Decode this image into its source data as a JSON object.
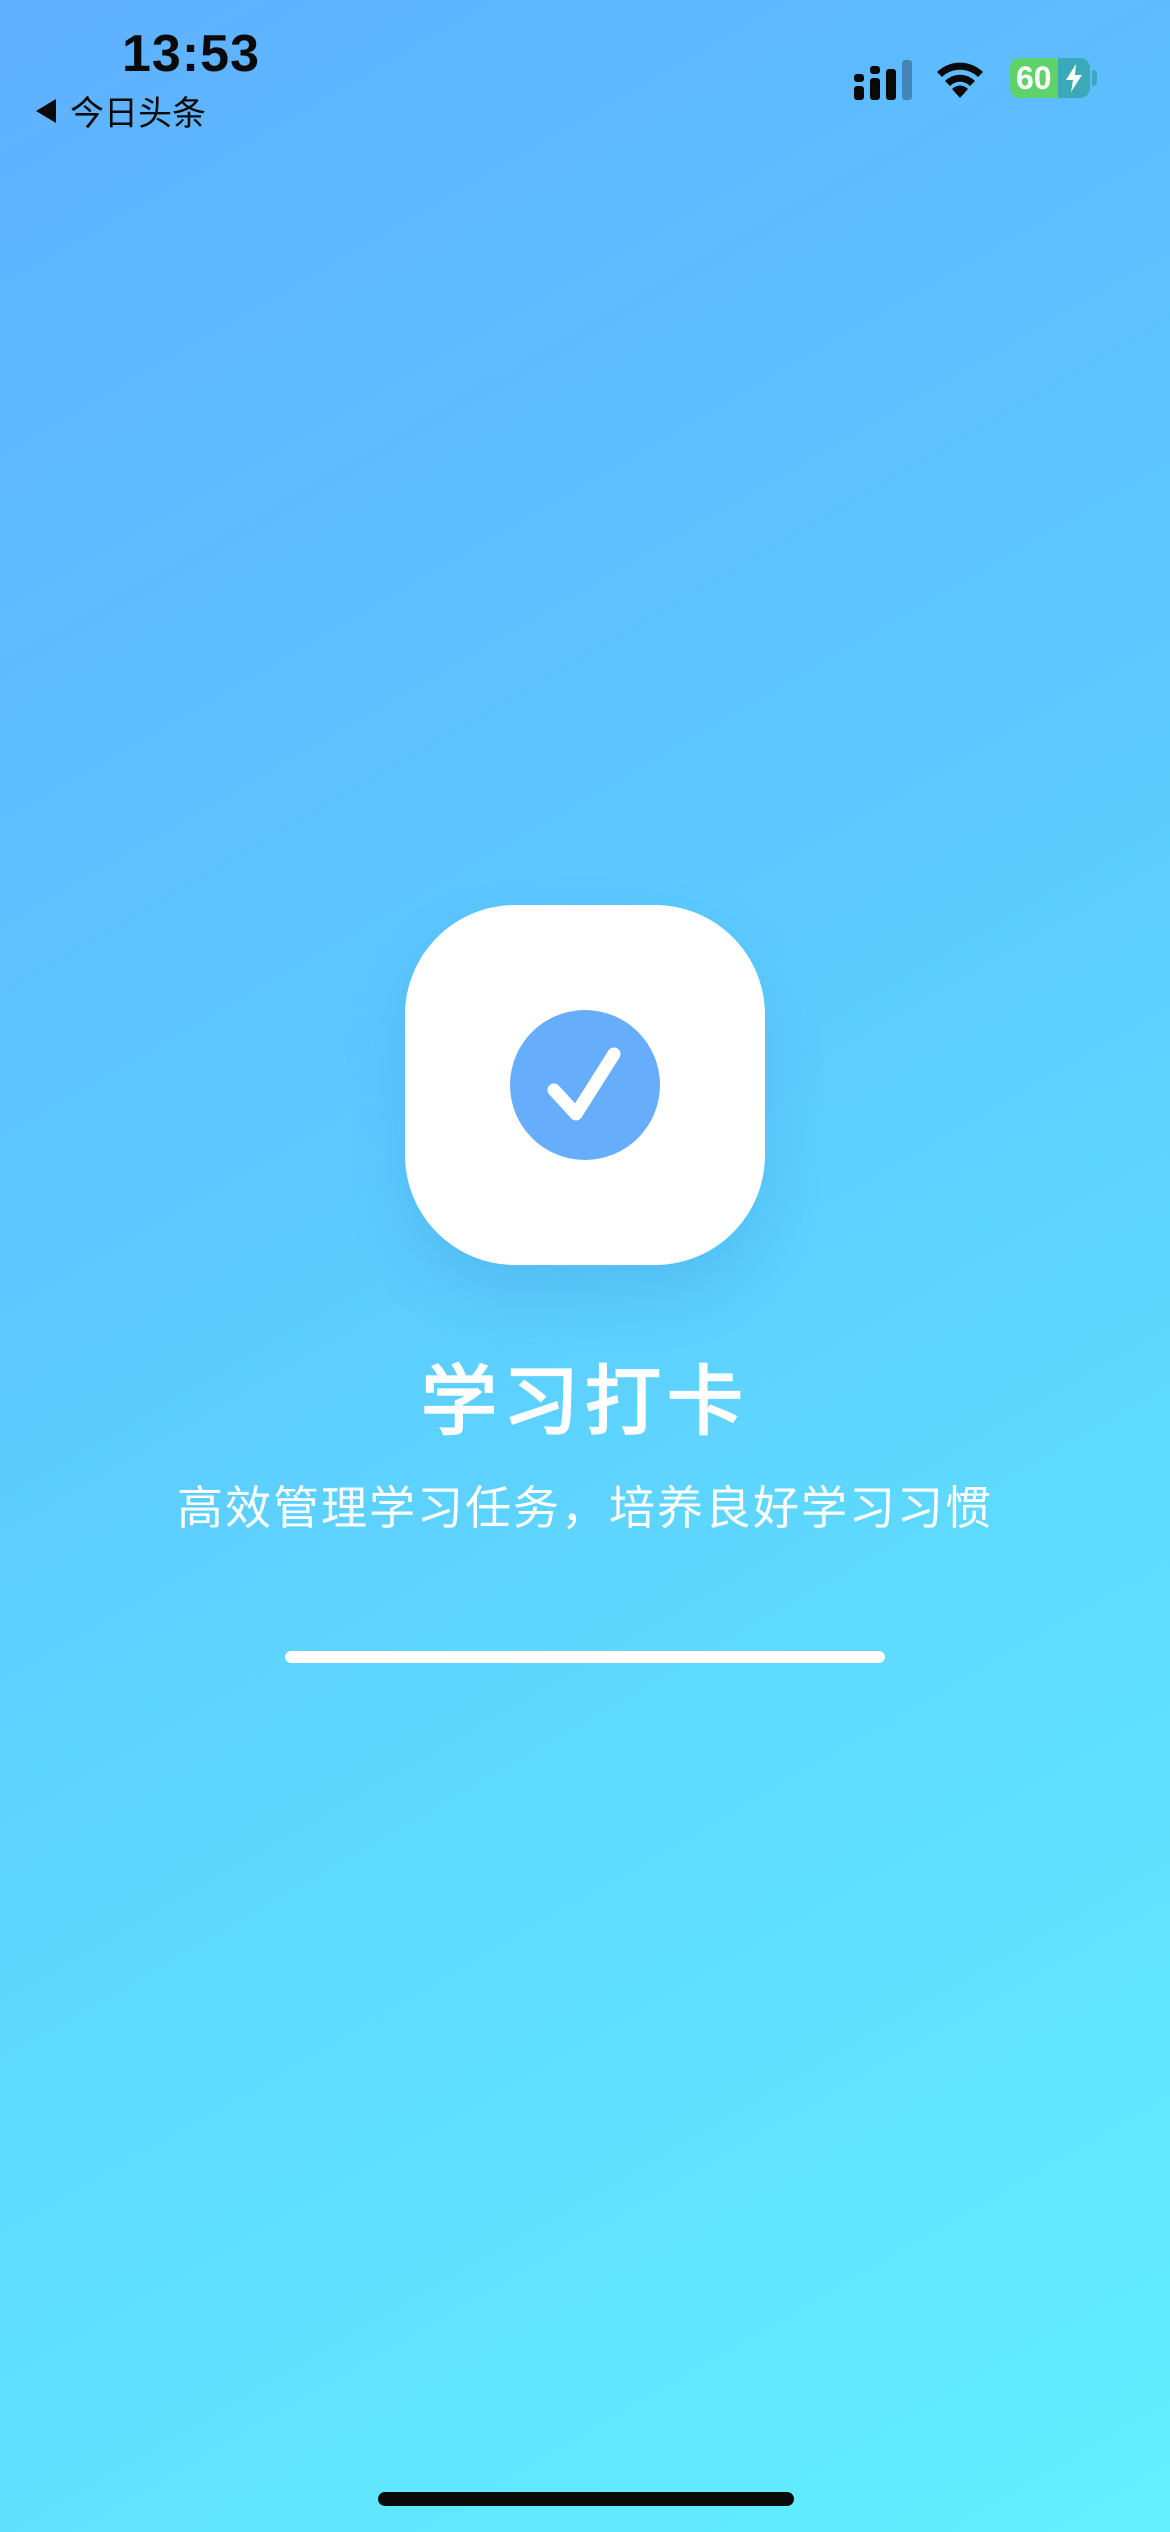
{
  "status_bar": {
    "time": "13:53",
    "back_label": "今日头条",
    "battery_level": "60",
    "battery_fraction": 0.6,
    "charging": true
  },
  "splash": {
    "icon": "check-icon",
    "title": "学习打卡",
    "subtitle": "高效管理学习任务，培养良好学习习惯",
    "progress": 1.0
  },
  "colors": {
    "background_start": "#5FB0FF",
    "background_end": "#62F0FF",
    "accent": "#66AEFB",
    "icon_tile": "#FFFFFF",
    "battery_green": "#5FD36A"
  }
}
